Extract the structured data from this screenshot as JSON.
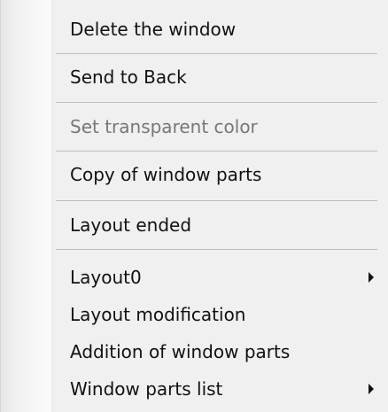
{
  "context_menu": {
    "items": [
      {
        "label": "Delete the window",
        "enabled": true
      },
      {
        "label": "Send to Back",
        "enabled": true
      },
      {
        "label": "Set transparent color",
        "enabled": false
      },
      {
        "label": "Copy of window parts",
        "enabled": true
      },
      {
        "label": "Layout ended",
        "enabled": true
      },
      {
        "label": "Layout0",
        "enabled": true,
        "submenu": true
      },
      {
        "label": "Layout modification",
        "enabled": true
      },
      {
        "label": "Addition of window parts",
        "enabled": true
      },
      {
        "label": "Window parts list",
        "enabled": true,
        "submenu": true
      }
    ]
  }
}
